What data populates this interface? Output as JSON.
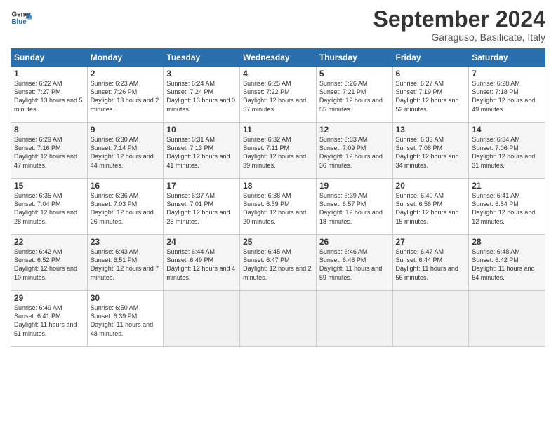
{
  "header": {
    "logo_line1": "General",
    "logo_line2": "Blue",
    "month_title": "September 2024",
    "subtitle": "Garaguso, Basilicate, Italy"
  },
  "weekdays": [
    "Sunday",
    "Monday",
    "Tuesday",
    "Wednesday",
    "Thursday",
    "Friday",
    "Saturday"
  ],
  "weeks": [
    [
      {
        "day": "1",
        "rise": "6:22 AM",
        "set": "7:27 PM",
        "daylight": "13 hours and 5 minutes."
      },
      {
        "day": "2",
        "rise": "6:23 AM",
        "set": "7:26 PM",
        "daylight": "13 hours and 2 minutes."
      },
      {
        "day": "3",
        "rise": "6:24 AM",
        "set": "7:24 PM",
        "daylight": "13 hours and 0 minutes."
      },
      {
        "day": "4",
        "rise": "6:25 AM",
        "set": "7:22 PM",
        "daylight": "12 hours and 57 minutes."
      },
      {
        "day": "5",
        "rise": "6:26 AM",
        "set": "7:21 PM",
        "daylight": "12 hours and 55 minutes."
      },
      {
        "day": "6",
        "rise": "6:27 AM",
        "set": "7:19 PM",
        "daylight": "12 hours and 52 minutes."
      },
      {
        "day": "7",
        "rise": "6:28 AM",
        "set": "7:18 PM",
        "daylight": "12 hours and 49 minutes."
      }
    ],
    [
      {
        "day": "8",
        "rise": "6:29 AM",
        "set": "7:16 PM",
        "daylight": "12 hours and 47 minutes."
      },
      {
        "day": "9",
        "rise": "6:30 AM",
        "set": "7:14 PM",
        "daylight": "12 hours and 44 minutes."
      },
      {
        "day": "10",
        "rise": "6:31 AM",
        "set": "7:13 PM",
        "daylight": "12 hours and 41 minutes."
      },
      {
        "day": "11",
        "rise": "6:32 AM",
        "set": "7:11 PM",
        "daylight": "12 hours and 39 minutes."
      },
      {
        "day": "12",
        "rise": "6:33 AM",
        "set": "7:09 PM",
        "daylight": "12 hours and 36 minutes."
      },
      {
        "day": "13",
        "rise": "6:33 AM",
        "set": "7:08 PM",
        "daylight": "12 hours and 34 minutes."
      },
      {
        "day": "14",
        "rise": "6:34 AM",
        "set": "7:06 PM",
        "daylight": "12 hours and 31 minutes."
      }
    ],
    [
      {
        "day": "15",
        "rise": "6:35 AM",
        "set": "7:04 PM",
        "daylight": "12 hours and 28 minutes."
      },
      {
        "day": "16",
        "rise": "6:36 AM",
        "set": "7:03 PM",
        "daylight": "12 hours and 26 minutes."
      },
      {
        "day": "17",
        "rise": "6:37 AM",
        "set": "7:01 PM",
        "daylight": "12 hours and 23 minutes."
      },
      {
        "day": "18",
        "rise": "6:38 AM",
        "set": "6:59 PM",
        "daylight": "12 hours and 20 minutes."
      },
      {
        "day": "19",
        "rise": "6:39 AM",
        "set": "6:57 PM",
        "daylight": "12 hours and 18 minutes."
      },
      {
        "day": "20",
        "rise": "6:40 AM",
        "set": "6:56 PM",
        "daylight": "12 hours and 15 minutes."
      },
      {
        "day": "21",
        "rise": "6:41 AM",
        "set": "6:54 PM",
        "daylight": "12 hours and 12 minutes."
      }
    ],
    [
      {
        "day": "22",
        "rise": "6:42 AM",
        "set": "6:52 PM",
        "daylight": "12 hours and 10 minutes."
      },
      {
        "day": "23",
        "rise": "6:43 AM",
        "set": "6:51 PM",
        "daylight": "12 hours and 7 minutes."
      },
      {
        "day": "24",
        "rise": "6:44 AM",
        "set": "6:49 PM",
        "daylight": "12 hours and 4 minutes."
      },
      {
        "day": "25",
        "rise": "6:45 AM",
        "set": "6:47 PM",
        "daylight": "12 hours and 2 minutes."
      },
      {
        "day": "26",
        "rise": "6:46 AM",
        "set": "6:46 PM",
        "daylight": "11 hours and 59 minutes."
      },
      {
        "day": "27",
        "rise": "6:47 AM",
        "set": "6:44 PM",
        "daylight": "11 hours and 56 minutes."
      },
      {
        "day": "28",
        "rise": "6:48 AM",
        "set": "6:42 PM",
        "daylight": "11 hours and 54 minutes."
      }
    ],
    [
      {
        "day": "29",
        "rise": "6:49 AM",
        "set": "6:41 PM",
        "daylight": "11 hours and 51 minutes."
      },
      {
        "day": "30",
        "rise": "6:50 AM",
        "set": "6:39 PM",
        "daylight": "11 hours and 48 minutes."
      },
      null,
      null,
      null,
      null,
      null
    ]
  ]
}
